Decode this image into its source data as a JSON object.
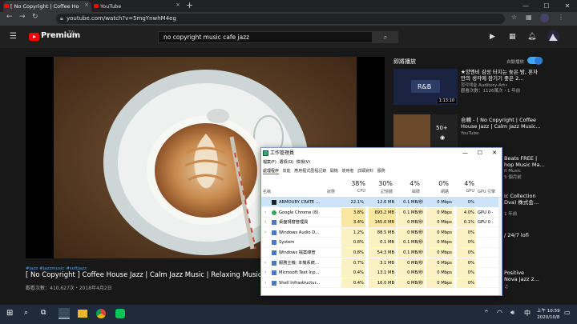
{
  "browser": {
    "tabs": [
      {
        "label": "[ No Copyright | Coffee Ho",
        "close": "×"
      },
      {
        "label": "YouTube",
        "close": "×"
      }
    ],
    "new_tab": "+",
    "window_buttons": [
      "—",
      "☐",
      "✕"
    ],
    "url": "youtube.com/watch?v=5mgYnwhM4eg"
  },
  "youtube": {
    "brand": "Premium",
    "brand_super": "TW",
    "search_value": "no copyright music cafe jazz",
    "video": {
      "tags": "#jazz #jazzmusic #softjazz",
      "title": "[ No Copyright ] Coffee House Jazz | Calm Jazz Music | Relaxing Music | Relax",
      "views": "觀看次數：410,627次・2018年4月2日"
    },
    "sidebar": {
      "header": "即將播放",
      "autoplay_label": "自動播放",
      "items": [
        {
          "title": "★양엔비 감성 터지는 늦은 밤, 혼자만의 생각에 잠기기 좋은 2...",
          "channel": "청각예술 Auditory-Art•",
          "meta": "觀看次數：1126萬次・1 年前",
          "thumb_text": "R&B",
          "duration": "1:13:10"
        },
        {
          "title": "合輯 - [ No Copyright | Coffee House Jazz | Calm Jazz Music...",
          "channel": "YouTube",
          "meta": "",
          "thumb_text": "50+",
          "duration": ""
        }
      ],
      "partial_titles": [
        "Beats FREE |",
        "hop Music Ma...",
        "fi Music",
        "5 個月前",
        "ic Collection",
        "Dva) 株式会...",
        "1 年前",
        "/ 24/7 lofi",
        "Positive",
        "Nova Jazz 2..."
      ]
    }
  },
  "task_manager": {
    "title": "工作管理員",
    "menu": [
      "檔案(F)",
      "選項(O)",
      "檢視(V)"
    ],
    "tabs": [
      "處理程序",
      "效能",
      "應用程式歷程記錄",
      "開機",
      "使用者",
      "詳細資料",
      "服務"
    ],
    "columns": {
      "name": "名稱",
      "status": "狀態",
      "cpu": {
        "pct": "38%",
        "label": "CPU"
      },
      "memory": {
        "pct": "30%",
        "label": "記憶體"
      },
      "disk": {
        "pct": "4%",
        "label": "磁碟"
      },
      "network": {
        "pct": "0%",
        "label": "網路"
      },
      "gpu": {
        "pct": "4%",
        "label": "GPU"
      },
      "gpu_engine": {
        "label": "GPU 引擎"
      }
    },
    "rows": [
      {
        "name": "ARMOURY CRATE ...",
        "cpu": "22.1%",
        "mem": "12.6 MB",
        "disk": "0.1 MB/秒",
        "net": "0 Mbps",
        "gpu": "0%",
        "engine": ""
      },
      {
        "name": "Google Chrome (8)",
        "cpu": "3.8%",
        "mem": "693.2 MB",
        "disk": "0.1 MB/秒",
        "net": "0 Mbps",
        "gpu": "4.0%",
        "engine": "GPU 0 -"
      },
      {
        "name": "桌面視窗管理員",
        "cpu": "3.4%",
        "mem": "145.0 MB",
        "disk": "0 MB/秒",
        "net": "0 Mbps",
        "gpu": "0.1%",
        "engine": "GPU 0 -"
      },
      {
        "name": "Windows Audio D...",
        "cpu": "1.2%",
        "mem": "88.5 MB",
        "disk": "0 MB/秒",
        "net": "0 Mbps",
        "gpu": "0%",
        "engine": ""
      },
      {
        "name": "System",
        "cpu": "0.8%",
        "mem": "0.1 MB",
        "disk": "0.1 MB/秒",
        "net": "0 Mbps",
        "gpu": "0%",
        "engine": ""
      },
      {
        "name": "Windows 檔案總管",
        "cpu": "0.8%",
        "mem": "54.3 MB",
        "disk": "0.1 MB/秒",
        "net": "0 Mbps",
        "gpu": "0%",
        "engine": ""
      },
      {
        "name": "服務主機: 本機系統...",
        "cpu": "0.7%",
        "mem": "3.1 MB",
        "disk": "0 MB/秒",
        "net": "0 Mbps",
        "gpu": "0%",
        "engine": ""
      },
      {
        "name": "Microsoft Text Inp...",
        "cpu": "0.4%",
        "mem": "13.1 MB",
        "disk": "0 MB/秒",
        "net": "0 Mbps",
        "gpu": "0%",
        "engine": ""
      },
      {
        "name": "Shell Infrastructur...",
        "cpu": "0.4%",
        "mem": "16.0 MB",
        "disk": "0 MB/秒",
        "net": "0 Mbps",
        "gpu": "0%",
        "engine": ""
      }
    ]
  },
  "taskbar": {
    "time": "上午 10:59",
    "date": "2020/10/8"
  },
  "colors": {
    "accent": "#3ea6ff",
    "yt_red": "#ff0000",
    "taskbar": "#1f2b3a"
  }
}
